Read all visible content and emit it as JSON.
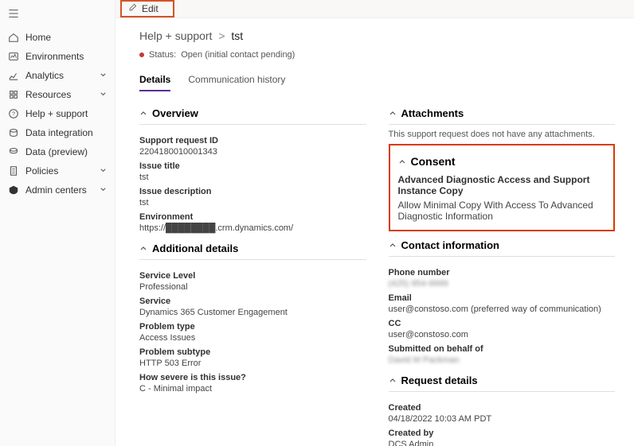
{
  "sidebar": {
    "items": [
      {
        "label": "Home"
      },
      {
        "label": "Environments"
      },
      {
        "label": "Analytics",
        "expandable": true
      },
      {
        "label": "Resources",
        "expandable": true
      },
      {
        "label": "Help + support"
      },
      {
        "label": "Data integration"
      },
      {
        "label": "Data (preview)"
      },
      {
        "label": "Policies",
        "expandable": true
      },
      {
        "label": "Admin centers",
        "expandable": true
      }
    ]
  },
  "topbar": {
    "edit_label": "Edit"
  },
  "breadcrumb": {
    "parent": "Help + support",
    "sep": ">",
    "current": "tst"
  },
  "status": {
    "label": "Status:",
    "value": "Open (initial contact pending)"
  },
  "tabs": {
    "details": "Details",
    "comm": "Communication history"
  },
  "overview": {
    "header": "Overview",
    "support_request_id_label": "Support request ID",
    "support_request_id": "2204180010001343",
    "issue_title_label": "Issue title",
    "issue_title": "tst",
    "issue_desc_label": "Issue description",
    "issue_desc": "tst",
    "environment_label": "Environment",
    "environment": "https://████████.crm.dynamics.com/"
  },
  "additional": {
    "header": "Additional details",
    "service_level_label": "Service Level",
    "service_level": "Professional",
    "service_label": "Service",
    "service": "Dynamics 365 Customer Engagement",
    "problem_type_label": "Problem type",
    "problem_type": "Access Issues",
    "problem_subtype_label": "Problem subtype",
    "problem_subtype": "HTTP 503 Error",
    "severity_label": "How severe is this issue?",
    "severity": "C - Minimal impact"
  },
  "attachments": {
    "header": "Attachments",
    "note": "This support request does not have any attachments."
  },
  "consent": {
    "header": "Consent",
    "title": "Advanced Diagnostic Access and Support Instance Copy",
    "desc": "Allow Minimal Copy With Access To Advanced Diagnostic Information"
  },
  "contact": {
    "header": "Contact information",
    "phone_label": "Phone number",
    "phone": "(425) 954-9999",
    "email_label": "Email",
    "email": "user@constoso.com (preferred way of communication)",
    "cc_label": "CC",
    "cc": "user@constoso.com",
    "behalf_label": "Submitted on behalf of",
    "behalf": "David M Packman"
  },
  "request": {
    "header": "Request details",
    "created_label": "Created",
    "created": "04/18/2022 10:03 AM PDT",
    "created_by_label": "Created by",
    "created_by": "DCS Admin"
  }
}
